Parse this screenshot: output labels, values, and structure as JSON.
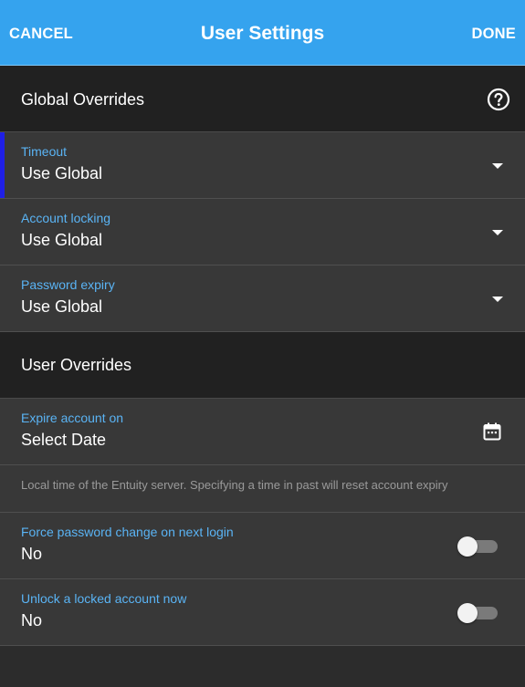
{
  "appbar": {
    "cancel_label": "CANCEL",
    "title": "User Settings",
    "done_label": "DONE",
    "background_color": "#35a3ee"
  },
  "global_overrides": {
    "header": "Global Overrides",
    "help_icon": "help-circle-icon",
    "fields": [
      {
        "label": "Timeout",
        "value": "Use Global",
        "icon": "dropdown-arrow-icon",
        "focused": true
      },
      {
        "label": "Account locking",
        "value": "Use Global",
        "icon": "dropdown-arrow-icon"
      },
      {
        "label": "Password expiry",
        "value": "Use Global",
        "icon": "dropdown-arrow-icon"
      }
    ]
  },
  "user_overrides": {
    "header": "User Overrides",
    "expire_account": {
      "label": "Expire account on",
      "value": "Select Date",
      "icon": "calendar-icon",
      "hint": "Local time of the Entuity server. Specifying a time in past will reset account expiry"
    },
    "force_password_change": {
      "label": "Force password change on next login",
      "value": "No",
      "toggle_on": false
    },
    "unlock_account": {
      "label": "Unlock a locked account now",
      "value": "No",
      "toggle_on": false
    }
  },
  "colors": {
    "accent_label": "#5ab4f5",
    "focus_indicator": "#1f1fe6",
    "row_background": "#383838",
    "header_background": "#212121"
  }
}
